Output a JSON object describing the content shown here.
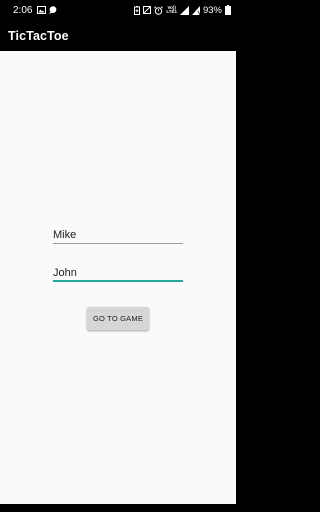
{
  "status_bar": {
    "time": "2:06",
    "battery_percent": "93%",
    "network_label_top": "Vo))",
    "network_label_bottom": "LTE1",
    "left_icons": [
      "image-icon",
      "chat-icon"
    ],
    "right_icons": [
      "battery-saver-icon",
      "mute-icon",
      "alarm-icon",
      "signal-icon",
      "battery-icon"
    ]
  },
  "app_bar": {
    "title": "TicTacToe"
  },
  "form": {
    "player1_value": "Mike",
    "player2_value": "John",
    "go_button_label": "GO TO GAME"
  },
  "colors": {
    "app_bar": "#000000",
    "background": "#fafafa",
    "accent_underline": "#26a69a",
    "button": "#d6d6d6"
  }
}
